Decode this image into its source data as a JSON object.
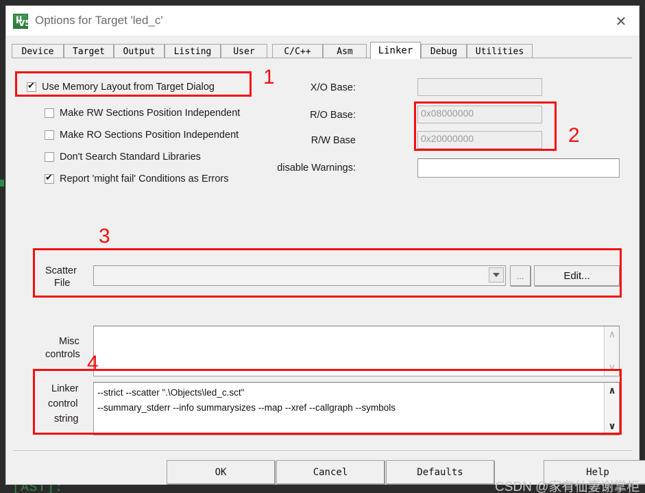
{
  "window": {
    "title": "Options for Target 'led_c'",
    "app_icon": "keil-uvision5-icon",
    "icon_mu": "µ",
    "icon_v5": "V5",
    "close_label": "✕"
  },
  "tabs": [
    {
      "label": "Device",
      "selected": false
    },
    {
      "label": "Target",
      "selected": false
    },
    {
      "label": "Output",
      "selected": false
    },
    {
      "label": "Listing",
      "selected": false
    },
    {
      "label": "User",
      "selected": false
    },
    {
      "label": "C/C++",
      "selected": false
    },
    {
      "label": "Asm",
      "selected": false
    },
    {
      "label": "Linker",
      "selected": true
    },
    {
      "label": "Debug",
      "selected": false
    },
    {
      "label": "Utilities",
      "selected": false
    }
  ],
  "checkboxes": [
    {
      "label": "Use Memory Layout from Target Dialog",
      "checked": true
    },
    {
      "label": "Make RW Sections Position Independent",
      "checked": false
    },
    {
      "label": "Make RO Sections Position Independent",
      "checked": false
    },
    {
      "label": "Don't Search Standard Libraries",
      "checked": false
    },
    {
      "label": "Report 'might fail' Conditions as Errors",
      "checked": true
    }
  ],
  "fields": {
    "xo_base_label": "X/O Base:",
    "xo_base_value": "",
    "ro_base_label": "R/O Base:",
    "ro_base_value": "0x08000000",
    "rw_base_label": "R/W Base",
    "rw_base_value": "0x20000000",
    "disable_warnings_label": "disable Warnings:",
    "disable_warnings_value": ""
  },
  "scatter": {
    "label_line1": "Scatter",
    "label_line2": "File",
    "value": "",
    "browse_label": "...",
    "edit_label": "Edit..."
  },
  "misc": {
    "label_line1": "Misc",
    "label_line2": "controls",
    "value": ""
  },
  "linker_control": {
    "label_line1": "Linker",
    "label_line2": "control",
    "label_line3": "string",
    "line1": "--strict --scatter \".\\Objects\\led_c.sct\"",
    "line2": "--summary_stderr --info summarysizes --map --xref --callgraph --symbols"
  },
  "buttons": {
    "ok": "OK",
    "cancel": "Cancel",
    "defaults": "Defaults",
    "help": "Help"
  },
  "annotations": {
    "n1": "1",
    "n2": "2",
    "n3": "3",
    "n4": "4",
    "color": "#f40f0f"
  },
  "watermark": "CSDN @家有仙妻谢掌柜",
  "background_text": "[AST]:"
}
